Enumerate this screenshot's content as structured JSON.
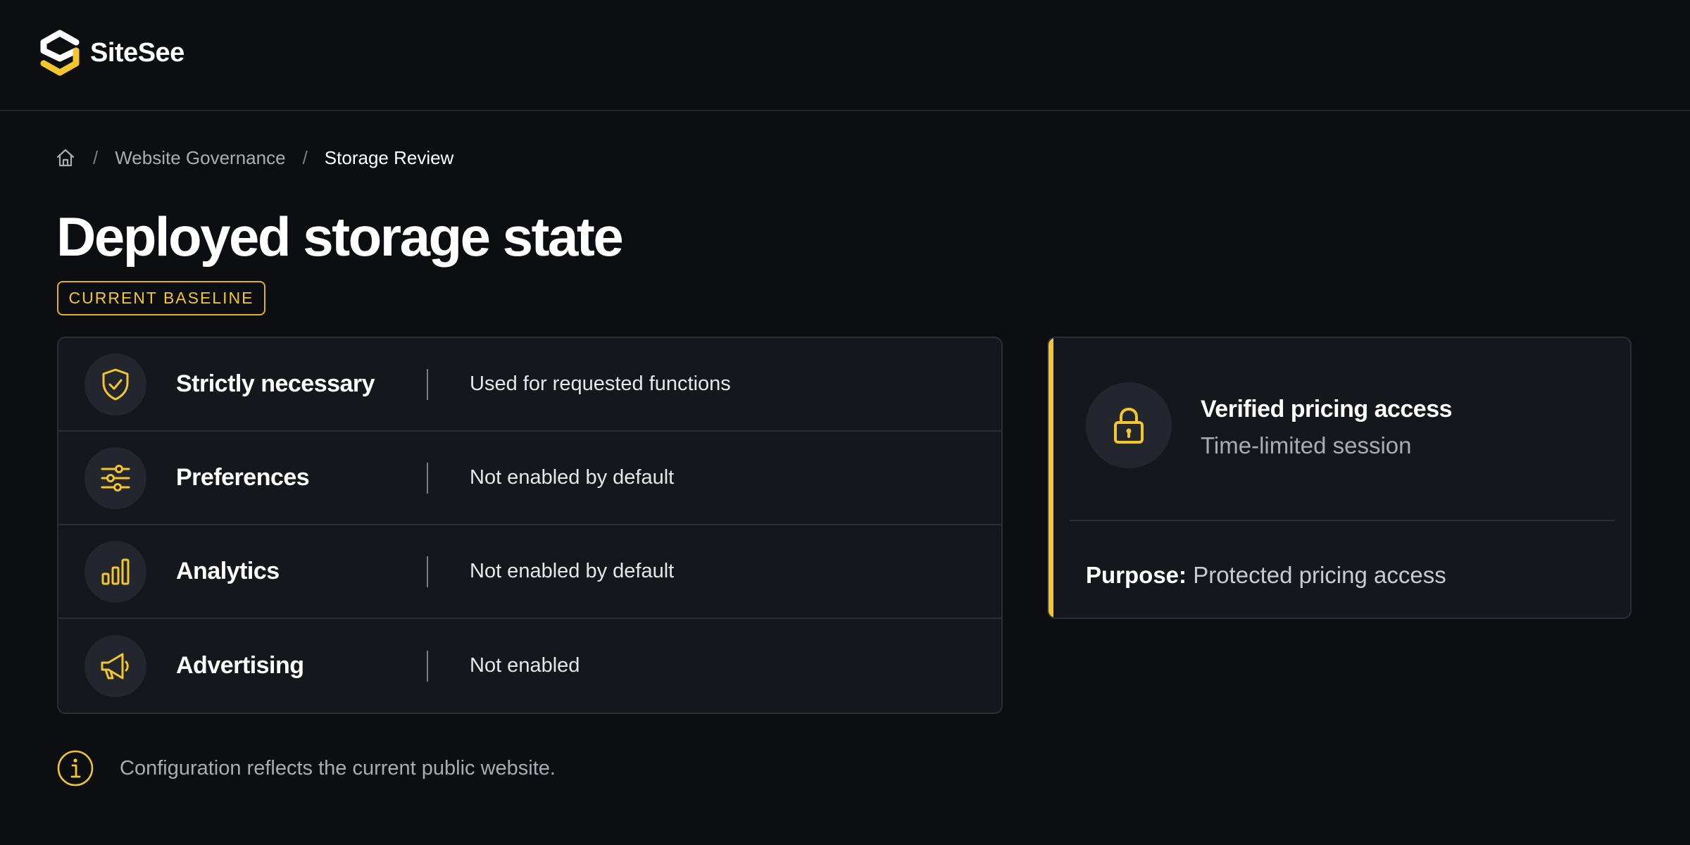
{
  "app": {
    "name": "SiteSee"
  },
  "breadcrumb": {
    "items": [
      "Website Governance",
      "Storage Review"
    ],
    "separator": "/"
  },
  "page": {
    "title": "Deployed storage state",
    "badge": "CURRENT BASELINE"
  },
  "categories": [
    {
      "label": "Strictly necessary",
      "status": "Used for requested functions",
      "icon": "shield-check-icon"
    },
    {
      "label": "Preferences",
      "status": "Not enabled by default",
      "icon": "sliders-icon"
    },
    {
      "label": "Analytics",
      "status": "Not enabled by default",
      "icon": "bar-chart-icon"
    },
    {
      "label": "Advertising",
      "status": "Not enabled",
      "icon": "megaphone-icon"
    }
  ],
  "session": {
    "title": "Verified pricing access",
    "subtitle": "Time-limited session",
    "purpose_label": "Purpose:",
    "purpose_value": "Protected pricing access",
    "icon": "lock-icon"
  },
  "footnote": {
    "text": "Configuration reflects the current public website.",
    "icon": "info-icon"
  },
  "colors": {
    "accent": "#f2c62c",
    "background": "#0c0e12",
    "card": "#15171c",
    "border": "#2b2e35"
  }
}
